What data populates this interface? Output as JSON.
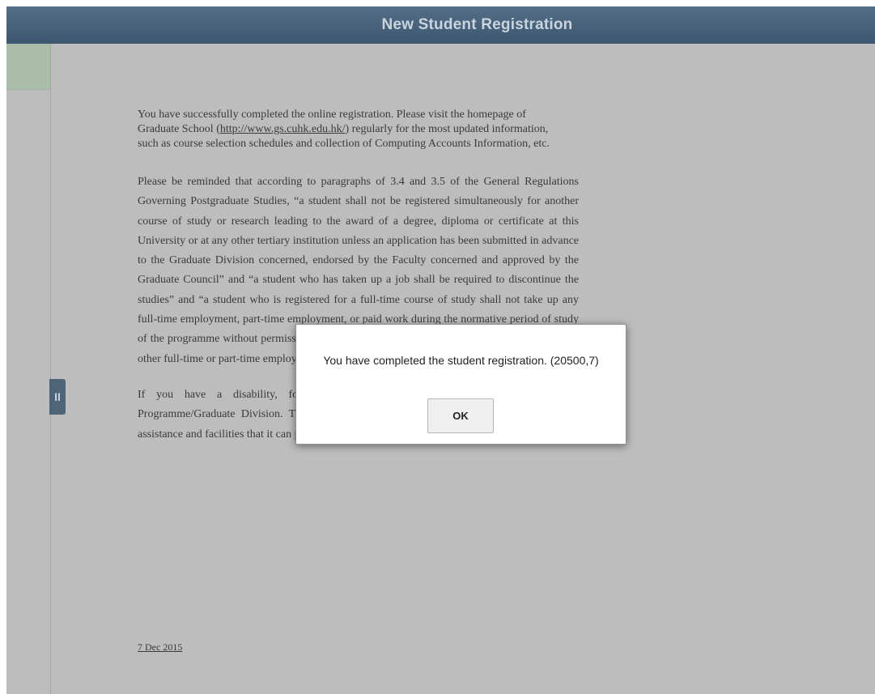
{
  "header": {
    "title": "New Student Registration"
  },
  "side_toggle": {
    "glyph": "II",
    "icon": "pause-icon"
  },
  "content": {
    "p1_before_link": "You have successfully completed the online registration. Please visit the homepage of Graduate School (",
    "p1_link": "http://www.gs.cuhk.edu.hk/",
    "p1_after_link": ") regularly for the most updated information, such as course selection schedules and collection of Computing Accounts Information, etc.",
    "p2": "Please be reminded that according to paragraphs of 3.4 and 3.5 of the General Regulations Governing Postgraduate Studies, “a student shall not be registered simultaneously for another course of study or research leading to the award of a degree, diploma or certificate at this University or at any other tertiary institution unless an application has been submitted in advance to the Graduate Division concerned, endorsed by the Faculty concerned and approved by the Graduate Council” and “a student who has taken up a job shall be required to discontinue the studies” and “a student who is registered for a full-time course of study shall not take up any full-time employment, part-time employment, or paid work during the normative period of study of the programme without permission. Recipient of a Postgraduate Studentship shall not take up other full-time or part-time employment, except by permission of the Graduate Council”.",
    "p3": "If you have a disability, for example, hearing impairment, please inform your Programme/Graduate Division. This can help the University/Programme to identify special assistance and facilities that it can provide you during your study.",
    "date": "7 Dec 2015"
  },
  "dialog": {
    "message": "You have completed the student registration. (20500,7)",
    "ok_label": "OK"
  },
  "colors": {
    "header_bg": "#4a637d",
    "header_text": "#c9d4de",
    "overlay_bg": "#bdbdbd",
    "panel_accent": "#a9bda9",
    "toggle_bg": "#4d6479"
  }
}
